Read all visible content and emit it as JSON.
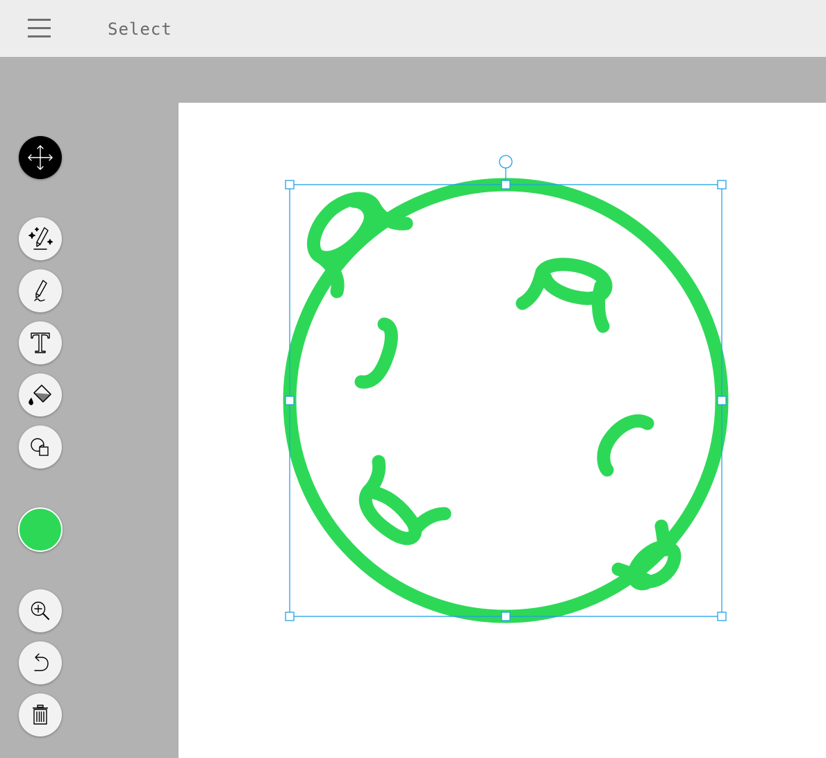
{
  "header": {
    "mode_label": "Select"
  },
  "toolbar": {
    "tools": [
      {
        "name": "move-tool",
        "icon": "move-arrows-icon",
        "active": true
      },
      {
        "name": "magic-pen-tool",
        "icon": "magic-pen-icon",
        "active": false
      },
      {
        "name": "pen-tool",
        "icon": "pen-icon",
        "active": false
      },
      {
        "name": "text-tool",
        "icon": "text-icon",
        "active": false
      },
      {
        "name": "fill-tool",
        "icon": "paint-bucket-icon",
        "active": false
      },
      {
        "name": "shapes-tool",
        "icon": "shapes-icon",
        "active": false
      },
      {
        "name": "zoom-tool",
        "icon": "zoom-in-icon",
        "active": false
      },
      {
        "name": "undo-button",
        "icon": "undo-icon",
        "active": false
      },
      {
        "name": "delete-button",
        "icon": "trash-icon",
        "active": false
      }
    ],
    "current_color": "#2ed857"
  },
  "colors": {
    "topbar": "#ededed",
    "sidebar": "#b2b2b2",
    "canvas": "#ffffff",
    "stroke": "#2ed857",
    "selection": "#1ea0e6"
  }
}
